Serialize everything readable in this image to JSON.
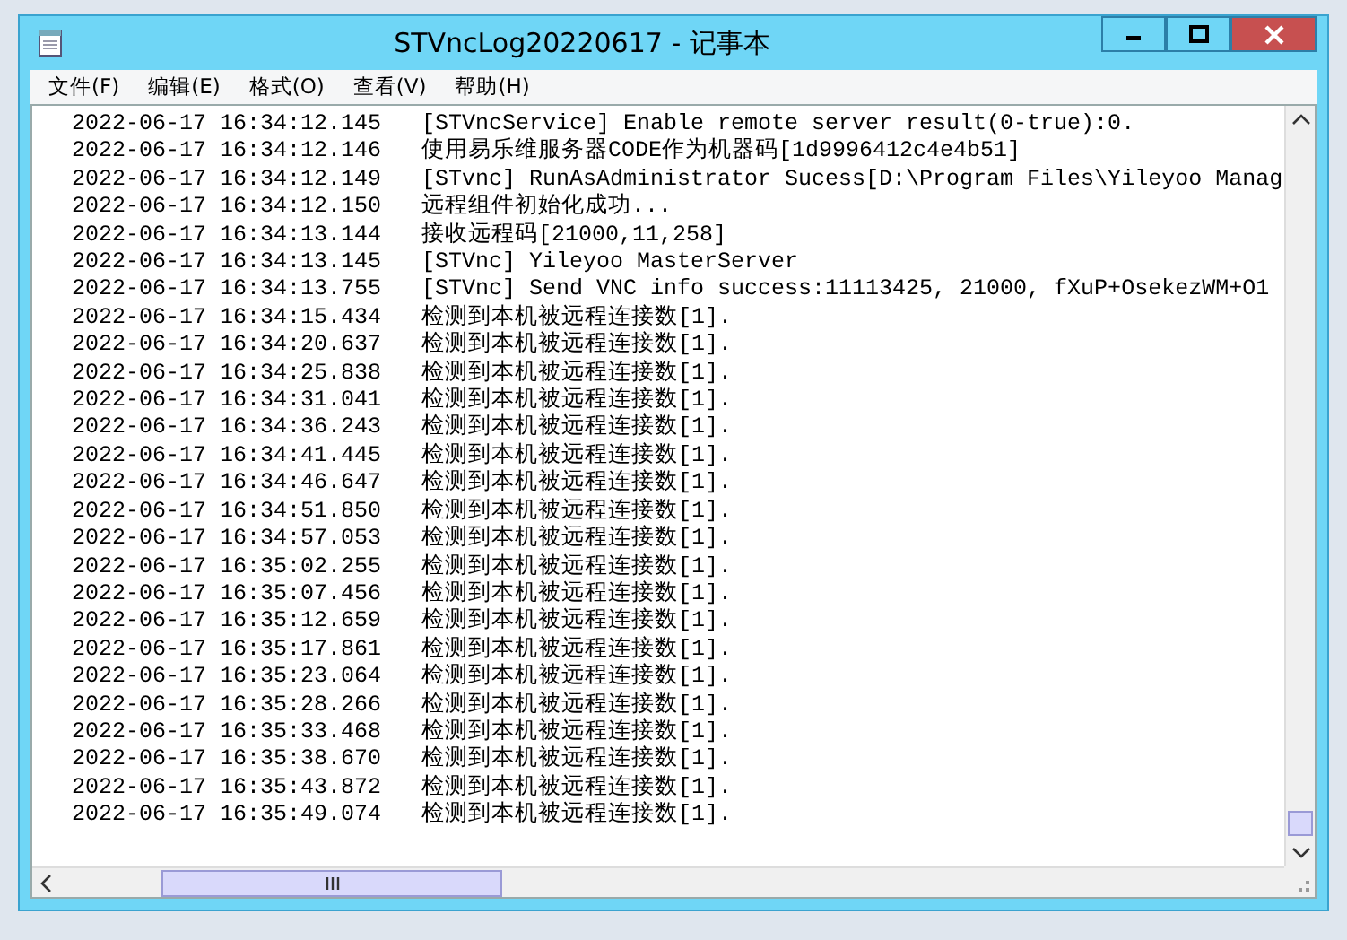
{
  "window": {
    "title": "STVncLog20220617 - 记事本"
  },
  "menu": [
    "文件(F)",
    "编辑(E)",
    "格式(O)",
    "查看(V)",
    "帮助(H)"
  ],
  "lines": [
    {
      "time": "2022-06-17 16:34:12.145",
      "message": "[STVncService] Enable remote server result(0-true):0."
    },
    {
      "time": "2022-06-17 16:34:12.146",
      "message": "使用易乐维服务器CODE作为机器码[1d9996412c4e4b51]"
    },
    {
      "time": "2022-06-17 16:34:12.149",
      "message": "[STvnc] RunAsAdministrator Sucess[D:\\Program Files\\Yileyoo Manag"
    },
    {
      "time": "2022-06-17 16:34:12.150",
      "message": "远程组件初始化成功..."
    },
    {
      "time": "2022-06-17 16:34:13.144",
      "message": "接收远程码[21000,11,258]"
    },
    {
      "time": "2022-06-17 16:34:13.145",
      "message": "[STVnc] Yileyoo MasterServer"
    },
    {
      "time": "2022-06-17 16:34:13.755",
      "message": "[STVnc] Send VNC info success:11113425, 21000, fXuP+OsekezWM+O1"
    },
    {
      "time": "2022-06-17 16:34:15.434",
      "message": "检测到本机被远程连接数[1]."
    },
    {
      "time": "2022-06-17 16:34:20.637",
      "message": "检测到本机被远程连接数[1]."
    },
    {
      "time": "2022-06-17 16:34:25.838",
      "message": "检测到本机被远程连接数[1]."
    },
    {
      "time": "2022-06-17 16:34:31.041",
      "message": "检测到本机被远程连接数[1]."
    },
    {
      "time": "2022-06-17 16:34:36.243",
      "message": "检测到本机被远程连接数[1]."
    },
    {
      "time": "2022-06-17 16:34:41.445",
      "message": "检测到本机被远程连接数[1]."
    },
    {
      "time": "2022-06-17 16:34:46.647",
      "message": "检测到本机被远程连接数[1]."
    },
    {
      "time": "2022-06-17 16:34:51.850",
      "message": "检测到本机被远程连接数[1]."
    },
    {
      "time": "2022-06-17 16:34:57.053",
      "message": "检测到本机被远程连接数[1]."
    },
    {
      "time": "2022-06-17 16:35:02.255",
      "message": "检测到本机被远程连接数[1]."
    },
    {
      "time": "2022-06-17 16:35:07.456",
      "message": "检测到本机被远程连接数[1]."
    },
    {
      "time": "2022-06-17 16:35:12.659",
      "message": "检测到本机被远程连接数[1]."
    },
    {
      "time": "2022-06-17 16:35:17.861",
      "message": "检测到本机被远程连接数[1]."
    },
    {
      "time": "2022-06-17 16:35:23.064",
      "message": "检测到本机被远程连接数[1]."
    },
    {
      "time": "2022-06-17 16:35:28.266",
      "message": "检测到本机被远程连接数[1]."
    },
    {
      "time": "2022-06-17 16:35:33.468",
      "message": "检测到本机被远程连接数[1]."
    },
    {
      "time": "2022-06-17 16:35:38.670",
      "message": "检测到本机被远程连接数[1]."
    },
    {
      "time": "2022-06-17 16:35:43.872",
      "message": "检测到本机被远程连接数[1]."
    },
    {
      "time": "2022-06-17 16:35:49.074",
      "message": "检测到本机被远程连接数[1]."
    }
  ]
}
